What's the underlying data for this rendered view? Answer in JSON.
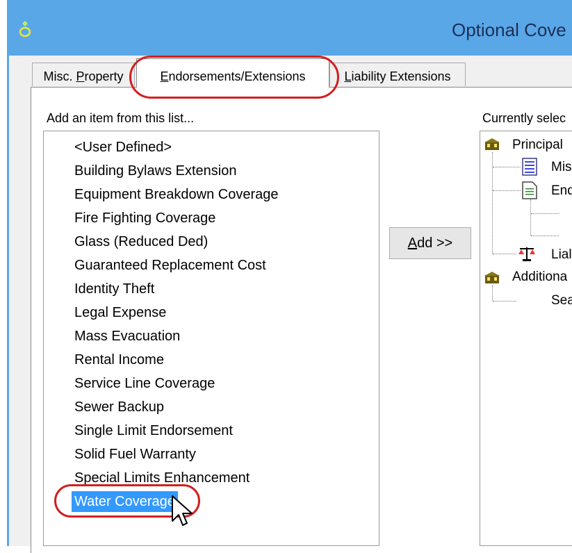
{
  "window": {
    "title": "Optional Cove"
  },
  "tabs": [
    {
      "label_pre": "Misc. ",
      "label_key": "P",
      "label_post": "roperty"
    },
    {
      "label_pre": "",
      "label_key": "E",
      "label_post": "ndorsements/Extensions",
      "selected": true
    },
    {
      "label_pre": "",
      "label_key": "L",
      "label_post": "iability Extensions"
    }
  ],
  "left_panel": {
    "label": "Add an item from this list...",
    "items": [
      "<User Defined>",
      "Building Bylaws Extension",
      "Equipment Breakdown Coverage",
      "Fire Fighting Coverage",
      "Glass (Reduced Ded)",
      "Guaranteed Replacement Cost",
      "Identity Theft",
      "Legal Expense",
      "Mass Evacuation",
      "Rental Income",
      "Service Line Coverage",
      "Sewer Backup",
      "Single Limit Endorsement",
      "Solid Fuel Warranty",
      "Special Limits Enhancement",
      "Water Coverage"
    ],
    "selected_item": "Water Coverage"
  },
  "add_button": {
    "key": "A",
    "rest": "dd >>"
  },
  "right_panel": {
    "label": "Currently selec",
    "tree": {
      "principal": "Principal",
      "misc": "Mis",
      "endorse": "End",
      "liability": "Lial",
      "additional": "Additiona",
      "sea": "Sea"
    }
  },
  "colors": {
    "titlebar": "#5aa7e8",
    "selection": "#3399ff",
    "highlight": "#d21f1f"
  },
  "icons": [
    "app-icon",
    "building-icon",
    "document-list-icon",
    "document-icon",
    "scales-icon",
    "mouse-pointer-icon"
  ]
}
